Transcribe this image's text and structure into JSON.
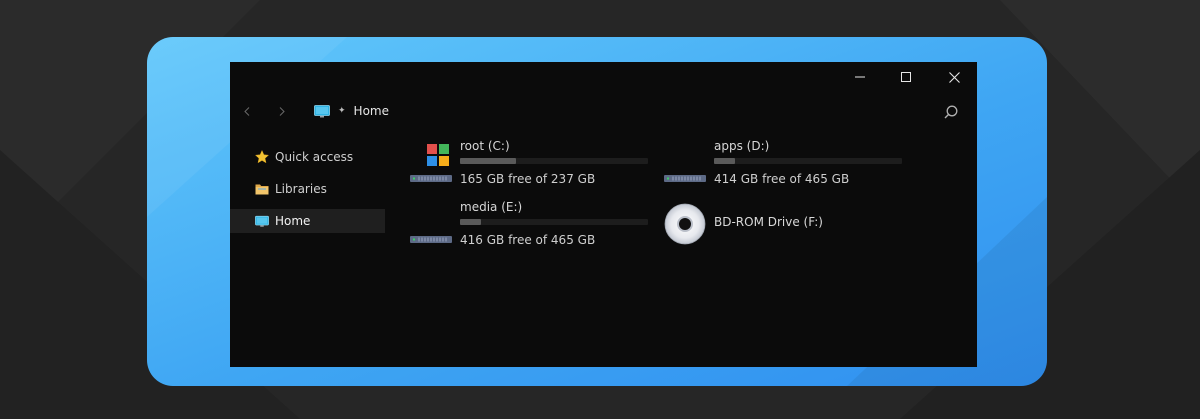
{
  "window": {
    "controls": {
      "minimize_icon": "minimize-icon",
      "maximize_icon": "maximize-icon",
      "close_icon": "close-icon"
    }
  },
  "address_bar": {
    "back_icon": "chevron-left-icon",
    "forward_icon": "chevron-right-icon",
    "location_icon": "monitor-icon",
    "separator": "✦",
    "location": "Home",
    "search_icon": "search-icon"
  },
  "sidebar": {
    "items": [
      {
        "label": "Quick access",
        "icon": "star-icon",
        "active": false
      },
      {
        "label": "Libraries",
        "icon": "folder-icon",
        "active": false
      },
      {
        "label": "Home",
        "icon": "monitor-icon",
        "active": true
      }
    ]
  },
  "drives": [
    {
      "name": "root (C:)",
      "free_text": "165 GB free of 237 GB",
      "used_fraction": 0.3,
      "icon": "windows-drive-icon"
    },
    {
      "name": "apps (D:)",
      "free_text": "414 GB free of 465 GB",
      "used_fraction": 0.11,
      "icon": "hard-drive-icon"
    },
    {
      "name": "media (E:)",
      "free_text": "416 GB free of 465 GB",
      "used_fraction": 0.11,
      "icon": "hard-drive-icon"
    },
    {
      "name": "BD-ROM Drive (F:)",
      "icon": "optical-disc-icon"
    }
  ],
  "colors": {
    "frame_gradient_start": "#62c8fb",
    "frame_gradient_end": "#2f8ff0",
    "window_bg": "#0b0b0b",
    "sidebar_active_bg": "#1f1f1f"
  }
}
